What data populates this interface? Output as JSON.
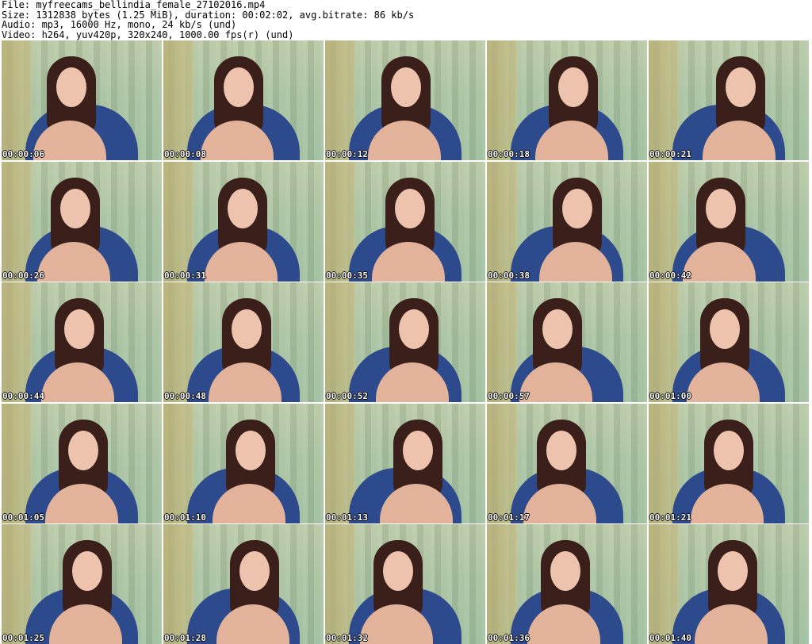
{
  "header": {
    "file": "File: myfreecams_bellindia_female_27102016.mp4",
    "size": "Size: 1312838 bytes (1.25 MiB), duration: 00:02:02, avg.bitrate: 86 kb/s",
    "audio": "Audio: mp3, 16000 Hz, mono, 24 kb/s (und)",
    "video": "Video: h264, yuv420p, 320x240, 1000.00 fps(r) (und)"
  },
  "thumbnails": [
    "00:00:06",
    "00:00:08",
    "00:00:12",
    "00:00:18",
    "00:00:21",
    "00:00:26",
    "00:00:31",
    "00:00:35",
    "00:00:38",
    "00:00:42",
    "00:00:44",
    "00:00:48",
    "00:00:52",
    "00:00:57",
    "00:01:00",
    "00:01:05",
    "00:01:10",
    "00:01:13",
    "00:01:17",
    "00:01:21",
    "00:01:25",
    "00:01:28",
    "00:01:32",
    "00:01:36",
    "00:01:40"
  ]
}
